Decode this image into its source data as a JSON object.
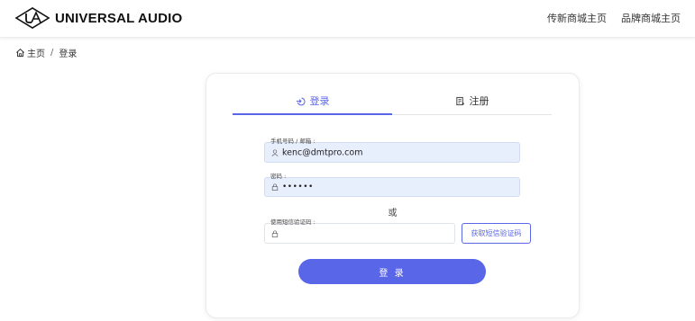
{
  "header": {
    "brand": "UNIVERSAL AUDIO",
    "nav": [
      "传新商城主页",
      "品牌商城主页"
    ]
  },
  "breadcrumb": {
    "home": "主页",
    "separator": "/",
    "current": "登录"
  },
  "tabs": [
    {
      "label": "登录",
      "icon": "login-icon",
      "active": true
    },
    {
      "label": "注册",
      "icon": "register-icon",
      "active": false
    }
  ],
  "form": {
    "account": {
      "label": "手机号码 / 邮箱 :",
      "value": "kenc@dmtpro.com",
      "icon": "user-icon"
    },
    "password": {
      "label": "密码 :",
      "value": "••••••",
      "icon": "lock-icon"
    },
    "or_text": "或",
    "sms": {
      "label": "使用短信验证码 :",
      "value": "",
      "icon": "lock-icon"
    },
    "get_code_label": "获取短信验证码",
    "submit_label": "登 录"
  },
  "colors": {
    "accent": "#5a66e8",
    "filled_input": "#e8effc"
  }
}
